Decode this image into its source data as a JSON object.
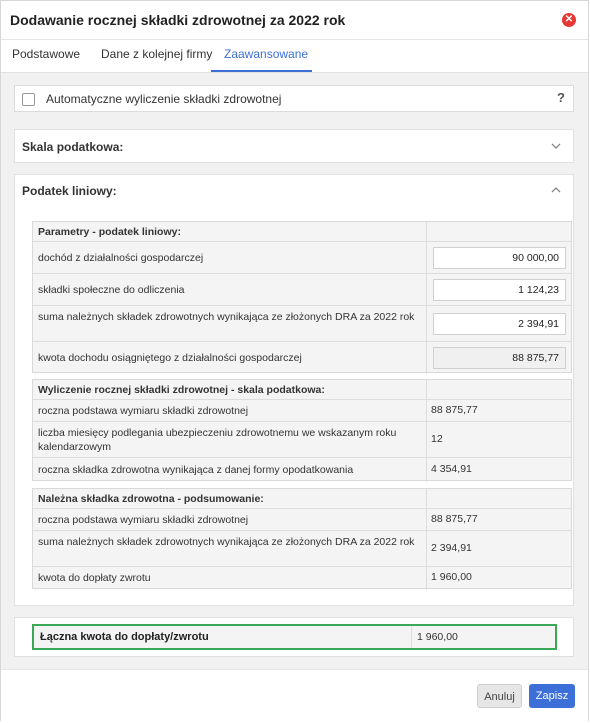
{
  "dialog": {
    "title": "Dodawanie rocznej składki zdrowotnej za 2022 rok",
    "close_icon": "close-icon",
    "accent_color": "#3d6fd8",
    "close_color": "#e53935",
    "highlight_color": "#3aa856"
  },
  "tabs": [
    {
      "label": "Podstawowe",
      "active": false
    },
    {
      "label": "Dane z kolejnej firmy",
      "active": false
    },
    {
      "label": "Zaawansowane",
      "active": true
    }
  ],
  "auto": {
    "label": "Automatyczne wyliczenie składki zdrowotnej",
    "checked": false,
    "help": "?"
  },
  "scale_panel": {
    "title": "Skala podatkowa:",
    "collapsed": true
  },
  "linear_panel": {
    "title": "Podatek liniowy:",
    "collapsed": false
  },
  "params": {
    "header": "Parametry - podatek liniowy:",
    "rows": [
      {
        "label": "dochód z działalności gospodarczej",
        "value": "90 000,00"
      },
      {
        "label": "składki społeczne do odliczenia",
        "value": "1 124,23"
      },
      {
        "label": "suma należnych składek zdrowotnych wynikająca ze złożonych DRA za 2022 rok",
        "value": "2 394,91"
      },
      {
        "label": "kwota dochodu osiągniętego z działalności gospodarczej",
        "value": "88 875,77"
      }
    ]
  },
  "calc": {
    "header": "Wyliczenie rocznej składki zdrowotnej - skala podatkowa:",
    "rows": [
      {
        "label": "roczna podstawa wymiaru składki zdrowotnej",
        "value": "88 875,77"
      },
      {
        "label": "liczba miesięcy podlegania ubezpieczeniu zdrowotnemu we wskazanym roku kalendarzowym",
        "value": "12"
      },
      {
        "label": "roczna składka zdrowotna wynikająca z danej formy opodatkowania",
        "value": "4 354,91"
      }
    ]
  },
  "summary": {
    "header": "Należna składka zdrowotna - podsumowanie:",
    "rows": [
      {
        "label": "roczna podstawa wymiaru składki zdrowotnej",
        "value": "88 875,77"
      },
      {
        "label": "suma należnych składek zdrowotnych wynikająca ze złożonych DRA za 2022 rok",
        "value": "2 394,91"
      },
      {
        "label": "kwota do dopłaty zwrotu",
        "value": "1 960,00"
      }
    ]
  },
  "total": {
    "label": "Łączna kwota do dopłaty/zwrotu",
    "value": "1 960,00"
  },
  "footer": {
    "cancel_label": "Anuluj",
    "save_label": "Zapisz"
  }
}
